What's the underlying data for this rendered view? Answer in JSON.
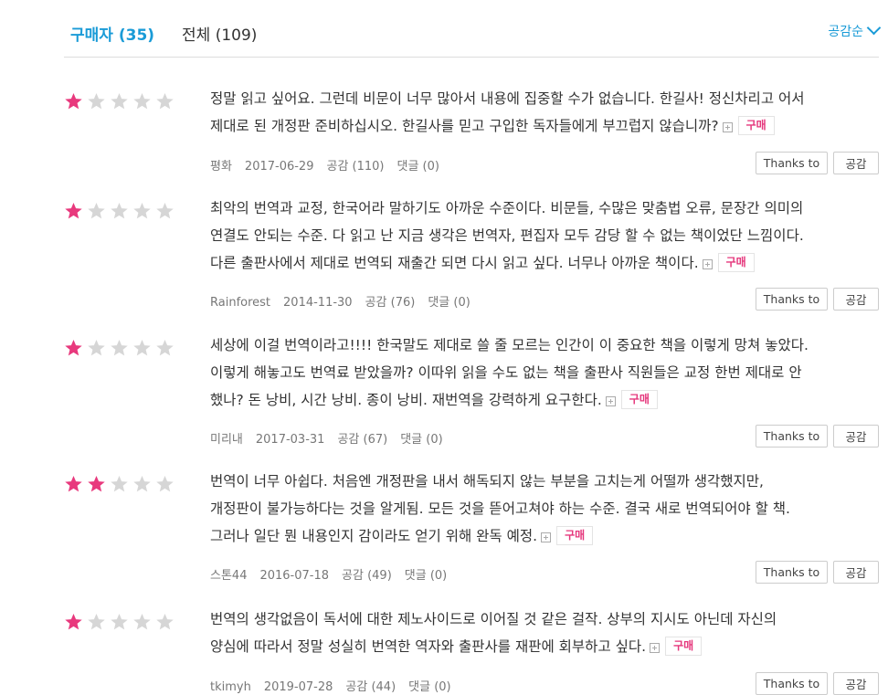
{
  "tabs": {
    "buyer_label": "구매자",
    "buyer_count": "(35)",
    "all_label": "전체",
    "all_count": "(109)",
    "sort_label": "공감순"
  },
  "colors": {
    "accent": "#1a9bd7",
    "star_on": "#e8397d",
    "star_off": "#d6d6d6",
    "badge": "#e5377c"
  },
  "buttons": {
    "thanks": "Thanks to",
    "like": "공감"
  },
  "reviews": [
    {
      "rating": 1,
      "lines": [
        "정말 읽고 싶어요. 그런데 비문이 너무 많아서 내용에 집중할 수가 없습니다. 한길사! 정신차리고 어서",
        "제대로 된 개정판 준비하십시오. 한길사를 믿고 구입한 독자들에게 부끄럽지 않습니까?"
      ],
      "badge": "구매",
      "author": "평화",
      "date": "2017-06-29",
      "likes": "공감 (110)",
      "comments": "댓글 (0)"
    },
    {
      "rating": 1,
      "lines": [
        "최악의 번역과 교정, 한국어라 말하기도 아까운 수준이다. 비문들, 수많은 맞춤법 오류, 문장간 의미의",
        "연결도 안되는 수준. 다 읽고 난 지금 생각은 번역자, 편집자 모두 감당 할 수 없는 책이었단 느낌이다.",
        "다른 출판사에서 제대로 번역되 재출간 되면 다시 읽고 싶다. 너무나 아까운 책이다."
      ],
      "badge": "구매",
      "author": "Rainforest",
      "date": "2014-11-30",
      "likes": "공감 (76)",
      "comments": "댓글 (0)"
    },
    {
      "rating": 1,
      "lines": [
        "세상에 이걸 번역이라고!!!! 한국말도 제대로 쓸 줄 모르는 인간이 이 중요한 책을 이렇게 망쳐 놓았다.",
        "이렇게 해놓고도 번역료 받았을까? 이따위 읽을 수도 없는 책을 출판사 직원들은 교정 한번 제대로 안",
        "했나? 돈 낭비, 시간 낭비. 종이 낭비. 재번역을 강력하게 요구한다."
      ],
      "badge": "구매",
      "author": "미리내",
      "date": "2017-03-31",
      "likes": "공감 (67)",
      "comments": "댓글 (0)"
    },
    {
      "rating": 2,
      "lines": [
        "번역이 너무 아쉽다. 처음엔 개정판을 내서 해독되지 않는 부분을 고치는게 어떨까 생각했지만,",
        "개정판이 불가능하다는 것을 알게됨. 모든 것을 뜯어고쳐야 하는 수준. 결국 새로 번역되어야 할 책.",
        "그러나 일단 뭔 내용인지 감이라도 얻기 위해 완독 예정."
      ],
      "badge": "구매",
      "author": "스톤44",
      "date": "2016-07-18",
      "likes": "공감 (49)",
      "comments": "댓글 (0)"
    },
    {
      "rating": 1,
      "lines": [
        "번역의 생각없음이 독서에 대한 제노사이드로 이어질 것 같은 걸작. 상부의 지시도 아닌데 자신의",
        "양심에 따라서 정말 성실히 번역한 역자와 출판사를 재판에 회부하고 싶다."
      ],
      "badge": "구매",
      "author": "tkimyh",
      "date": "2019-07-28",
      "likes": "공감 (44)",
      "comments": "댓글 (0)"
    }
  ]
}
